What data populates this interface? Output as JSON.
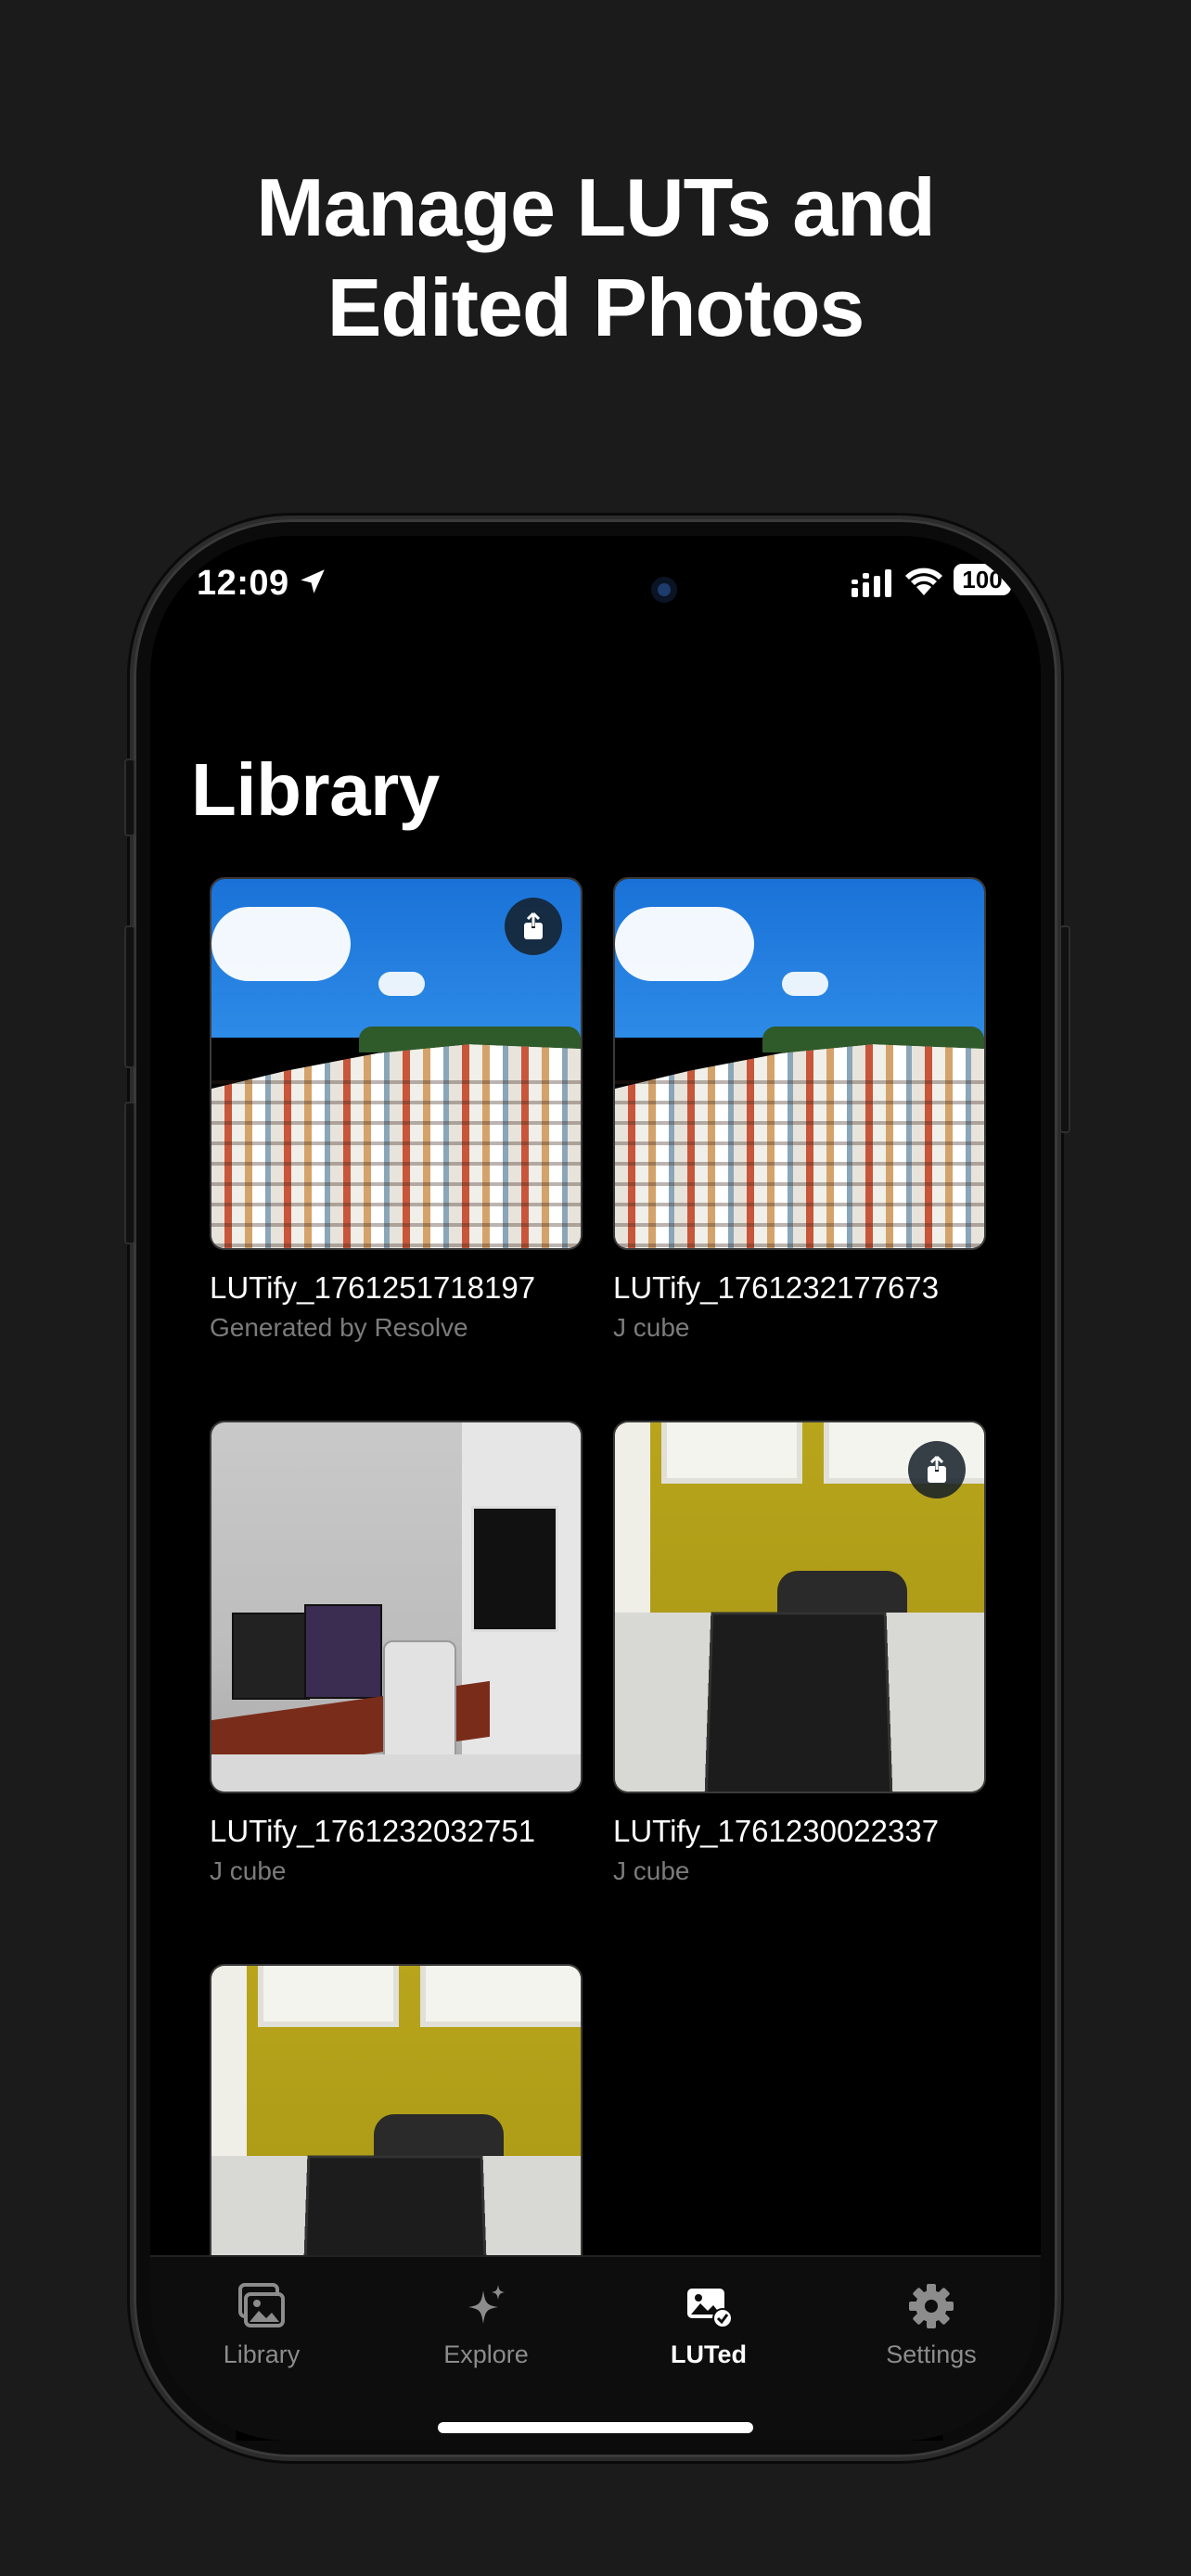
{
  "headline": {
    "line1": "Manage LUTs and",
    "line2": "Edited Photos"
  },
  "status_bar": {
    "time": "12:09",
    "battery": "100"
  },
  "library": {
    "title": "Library",
    "items": [
      {
        "name": "LUTify_1761251718197",
        "subtitle": "Generated by Resolve",
        "photo": "town",
        "share": true
      },
      {
        "name": "LUTify_1761232177673",
        "subtitle": "J cube",
        "photo": "town",
        "share": false
      },
      {
        "name": "LUTify_1761232032751",
        "subtitle": "J cube",
        "photo": "desk",
        "share": false
      },
      {
        "name": "LUTify_1761230022337",
        "subtitle": "J cube",
        "photo": "office",
        "share": true
      },
      {
        "name": "",
        "subtitle": "",
        "photo": "office",
        "share": false
      }
    ]
  },
  "tabbar": {
    "tabs": [
      {
        "label": "Library",
        "icon": "photo-library-icon",
        "active": false
      },
      {
        "label": "Explore",
        "icon": "sparkles-icon",
        "active": false
      },
      {
        "label": "LUTed",
        "icon": "photo-checkmark-icon",
        "active": true
      },
      {
        "label": "Settings",
        "icon": "gear-icon",
        "active": false
      }
    ]
  },
  "colors": {
    "page_bg": "#1b1b1b",
    "screen_bg": "#000000",
    "text_primary": "#ffffff",
    "text_secondary": "#7b7b7b",
    "tab_inactive": "#8c8c8c"
  }
}
